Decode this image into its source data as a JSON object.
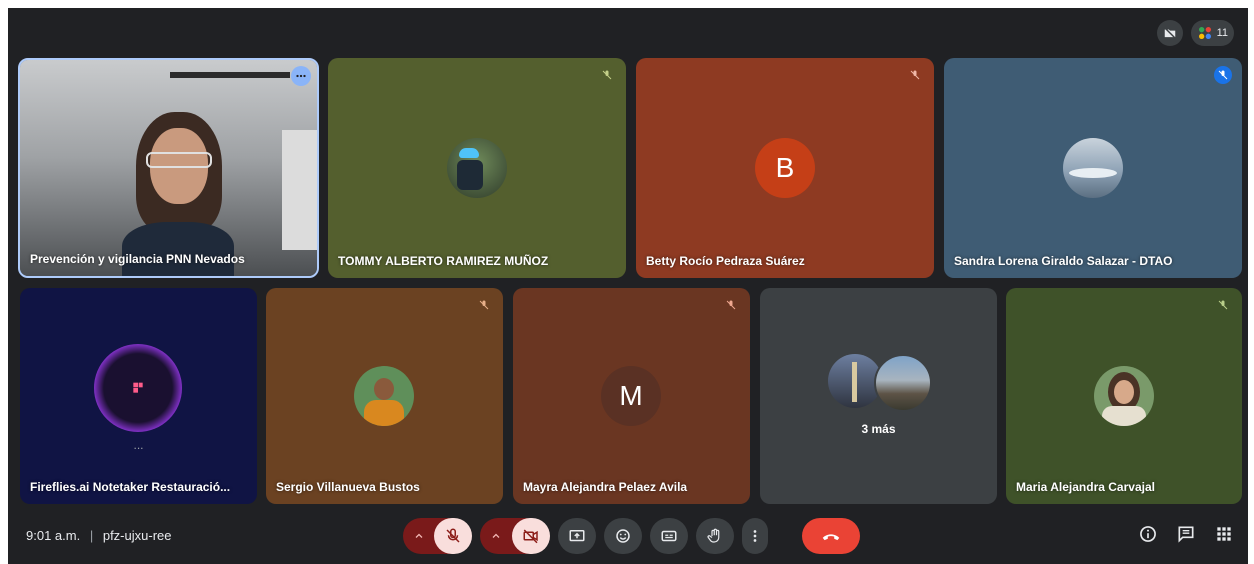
{
  "top": {
    "participants_count": "11"
  },
  "tiles": {
    "t1": {
      "name": "Prevención y vigilancia PNN Nevados"
    },
    "t2": {
      "name": "TOMMY ALBERTO RAMIREZ MUÑOZ"
    },
    "t3": {
      "name": "Betty Rocío Pedraza Suárez",
      "initial": "B"
    },
    "t4": {
      "name": "Sandra Lorena Giraldo Salazar - DTAO"
    },
    "t5": {
      "name": "Fireflies.ai Notetaker Restauració...",
      "dots": "..."
    },
    "t6": {
      "name": "Sergio Villanueva Bustos"
    },
    "t7": {
      "name": "Mayra Alejandra Pelaez Avila",
      "initial": "M"
    },
    "t8": {
      "more_label": "3 más"
    },
    "t9": {
      "name": "Maria Alejandra Carvajal"
    }
  },
  "bottom": {
    "time": "9:01 a.m.",
    "separator": "|",
    "meeting_code": "pfz-ujxu-ree"
  },
  "colors": {
    "background": "#202124",
    "end_call": "#ea4335",
    "muted_control": "#f9dedc",
    "accent_blue": "#8ab4f8"
  }
}
